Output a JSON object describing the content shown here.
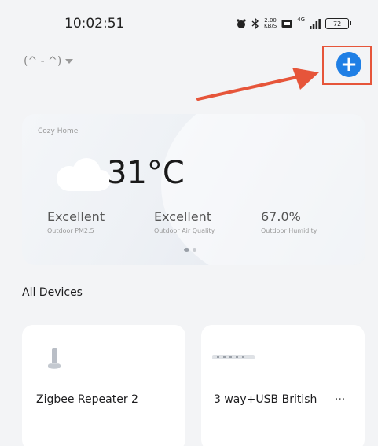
{
  "status_bar": {
    "time": "10:02:51",
    "net_speed_value": "2.00",
    "net_speed_unit": "KB/S",
    "network_type": "4G",
    "battery_level": "72"
  },
  "header": {
    "home_selector_label": "(^ - ^)",
    "add_button_symbol": "+"
  },
  "weather": {
    "home_name": "Cozy Home",
    "temperature": "31°C",
    "metrics": [
      {
        "value": "Excellent",
        "label": "Outdoor PM2.5"
      },
      {
        "value": "Excellent",
        "label": "Outdoor Air Quality"
      },
      {
        "value": "67.0%",
        "label": "Outdoor Humidity"
      }
    ],
    "pager_pages": 2,
    "pager_active": 0
  },
  "devices_section": {
    "title": "All Devices"
  },
  "devices": [
    {
      "name": "Zigbee Repeater 2",
      "icon": "zigbee-repeater-icon"
    },
    {
      "name": "3 way+USB British",
      "icon": "power-strip-icon",
      "more": "···"
    }
  ],
  "colors": {
    "accent": "#1f7fe5",
    "annotation": "#e6553a"
  }
}
